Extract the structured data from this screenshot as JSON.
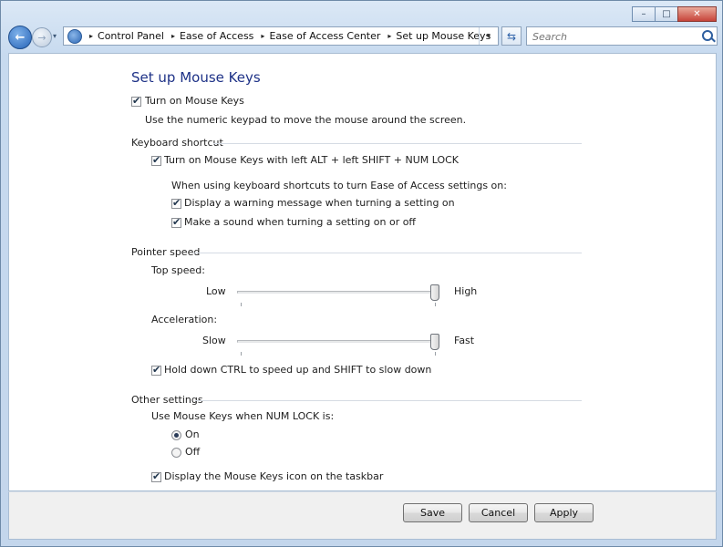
{
  "window": {
    "minimize_glyph": "–",
    "maximize_glyph": "□",
    "close_glyph": "✕"
  },
  "nav": {
    "back_glyph": "←",
    "forward_glyph": "→",
    "dropdown_glyph": "▾",
    "breadcrumb": [
      "Control Panel",
      "Ease of Access",
      "Ease of Access Center",
      "Set up Mouse Keys"
    ],
    "breadcrumb_sep": "▸",
    "refresh_glyph": "⇆",
    "search_placeholder": "Search"
  },
  "page": {
    "title": "Set up Mouse Keys",
    "turn_on_label": "Turn on Mouse Keys",
    "turn_on_checked": true,
    "description": "Use the numeric keypad to move the mouse around the screen.",
    "keyboard_shortcut": {
      "heading": "Keyboard shortcut",
      "shortcut_label": "Turn on Mouse Keys with left ALT + left SHIFT + NUM LOCK",
      "shortcut_checked": true,
      "sub_intro": "When using keyboard shortcuts to turn Ease of Access settings on:",
      "warning_label": "Display a warning message when turning a setting on",
      "warning_checked": true,
      "sound_label": "Make a sound when turning a setting on or off",
      "sound_checked": true
    },
    "pointer_speed": {
      "heading": "Pointer speed",
      "top_speed_label": "Top speed:",
      "top_speed_low": "Low",
      "top_speed_high": "High",
      "top_speed_value": 1.0,
      "acceleration_label": "Acceleration:",
      "acceleration_low": "Slow",
      "acceleration_high": "Fast",
      "acceleration_value": 1.0,
      "ctrl_shift_label": "Hold down CTRL to speed up and SHIFT to slow down",
      "ctrl_shift_checked": true
    },
    "other_settings": {
      "heading": "Other settings",
      "numlock_label": "Use Mouse Keys when NUM LOCK is:",
      "option_on": "On",
      "option_off": "Off",
      "selected": "On",
      "taskbar_icon_label": "Display the Mouse Keys icon on the taskbar",
      "taskbar_icon_checked": true
    }
  },
  "footer": {
    "save_label": "Save",
    "cancel_label": "Cancel",
    "apply_label": "Apply"
  },
  "colors": {
    "title": "#1e3287",
    "frame": "#c3d6ec",
    "content_bg": "#ffffff"
  }
}
